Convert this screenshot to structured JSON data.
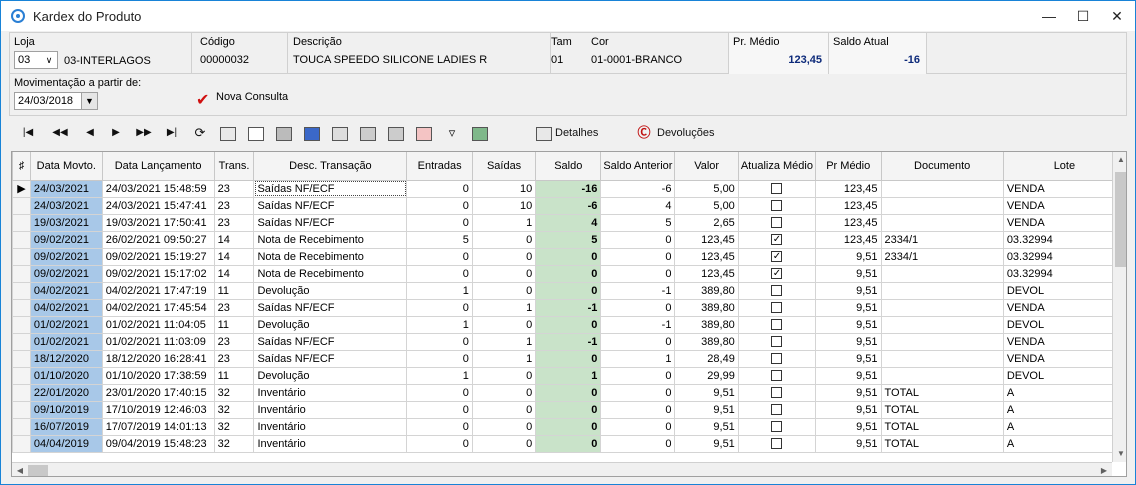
{
  "window": {
    "title": "Kardex do Produto",
    "min": "—",
    "max": "☐",
    "close": "✕"
  },
  "header": {
    "loja_label": "Loja",
    "loja_code": "03",
    "loja_name": "03-INTERLAGOS",
    "codigo_label": "Código",
    "codigo_value": "00000032",
    "descricao_label": "Descrição",
    "descricao_value": "TOUCA SPEEDO SILICONE LADIES R",
    "tam_label": "Tam",
    "tam_value": "01",
    "cor_label": "Cor",
    "cor_value": "01-0001-BRANCO",
    "pr_medio_label": "Pr. Médio",
    "pr_medio_value": "123,45",
    "saldo_atual_label": "Saldo Atual",
    "saldo_atual_value": "-16",
    "mov_label": "Movimentação a partir de:",
    "mov_date": "24/03/2018",
    "nova_consulta": "Nova Consulta"
  },
  "toolbar": {
    "detalhes": "Detalhes",
    "devolucoes": "Devoluções"
  },
  "columns": [
    "Data Movto.",
    "Data Lançamento",
    "Trans.",
    "Desc. Transação",
    "Entradas",
    "Saídas",
    "Saldo",
    "Saldo Anterior",
    "Valor",
    "Atualiza Médio",
    "Pr Médio",
    "Documento",
    "Lote"
  ],
  "rows": [
    {
      "dm": "24/03/2021",
      "dl": "24/03/2021 15:48:59",
      "tr": "23",
      "ds": "Saídas NF/ECF",
      "en": "0",
      "sa": "10",
      "sl": "-16",
      "ant": "-6",
      "val": "5,00",
      "chk": false,
      "pm": "123,45",
      "doc": "",
      "lote": "VENDA"
    },
    {
      "dm": "24/03/2021",
      "dl": "24/03/2021 15:47:41",
      "tr": "23",
      "ds": "Saídas NF/ECF",
      "en": "0",
      "sa": "10",
      "sl": "-6",
      "ant": "4",
      "val": "5,00",
      "chk": false,
      "pm": "123,45",
      "doc": "",
      "lote": "VENDA"
    },
    {
      "dm": "19/03/2021",
      "dl": "19/03/2021 17:50:41",
      "tr": "23",
      "ds": "Saídas NF/ECF",
      "en": "0",
      "sa": "1",
      "sl": "4",
      "ant": "5",
      "val": "2,65",
      "chk": false,
      "pm": "123,45",
      "doc": "",
      "lote": "VENDA"
    },
    {
      "dm": "09/02/2021",
      "dl": "26/02/2021 09:50:27",
      "tr": "14",
      "ds": "Nota de Recebimento",
      "en": "5",
      "sa": "0",
      "sl": "5",
      "ant": "0",
      "val": "123,45",
      "chk": true,
      "pm": "123,45",
      "doc": "2334/1",
      "lote": "03.32994"
    },
    {
      "dm": "09/02/2021",
      "dl": "09/02/2021 15:19:27",
      "tr": "14",
      "ds": "Nota de Recebimento",
      "en": "0",
      "sa": "0",
      "sl": "0",
      "ant": "0",
      "val": "123,45",
      "chk": true,
      "pm": "9,51",
      "doc": "2334/1",
      "lote": "03.32994"
    },
    {
      "dm": "09/02/2021",
      "dl": "09/02/2021 15:17:02",
      "tr": "14",
      "ds": "Nota de Recebimento",
      "en": "0",
      "sa": "0",
      "sl": "0",
      "ant": "0",
      "val": "123,45",
      "chk": true,
      "pm": "9,51",
      "doc": "",
      "lote": "03.32994"
    },
    {
      "dm": "04/02/2021",
      "dl": "04/02/2021 17:47:19",
      "tr": "11",
      "ds": "Devolução",
      "en": "1",
      "sa": "0",
      "sl": "0",
      "ant": "-1",
      "val": "389,80",
      "chk": false,
      "pm": "9,51",
      "doc": "",
      "lote": "DEVOL"
    },
    {
      "dm": "04/02/2021",
      "dl": "04/02/2021 17:45:54",
      "tr": "23",
      "ds": "Saídas NF/ECF",
      "en": "0",
      "sa": "1",
      "sl": "-1",
      "ant": "0",
      "val": "389,80",
      "chk": false,
      "pm": "9,51",
      "doc": "",
      "lote": "VENDA"
    },
    {
      "dm": "01/02/2021",
      "dl": "01/02/2021 11:04:05",
      "tr": "11",
      "ds": "Devolução",
      "en": "1",
      "sa": "0",
      "sl": "0",
      "ant": "-1",
      "val": "389,80",
      "chk": false,
      "pm": "9,51",
      "doc": "",
      "lote": "DEVOL"
    },
    {
      "dm": "01/02/2021",
      "dl": "01/02/2021 11:03:09",
      "tr": "23",
      "ds": "Saídas NF/ECF",
      "en": "0",
      "sa": "1",
      "sl": "-1",
      "ant": "0",
      "val": "389,80",
      "chk": false,
      "pm": "9,51",
      "doc": "",
      "lote": "VENDA"
    },
    {
      "dm": "18/12/2020",
      "dl": "18/12/2020 16:28:41",
      "tr": "23",
      "ds": "Saídas NF/ECF",
      "en": "0",
      "sa": "1",
      "sl": "0",
      "ant": "1",
      "val": "28,49",
      "chk": false,
      "pm": "9,51",
      "doc": "",
      "lote": "VENDA"
    },
    {
      "dm": "01/10/2020",
      "dl": "01/10/2020 17:38:59",
      "tr": "11",
      "ds": "Devolução",
      "en": "1",
      "sa": "0",
      "sl": "1",
      "ant": "0",
      "val": "29,99",
      "chk": false,
      "pm": "9,51",
      "doc": "",
      "lote": "DEVOL"
    },
    {
      "dm": "22/01/2020",
      "dl": "23/01/2020 17:40:15",
      "tr": "32",
      "ds": "Inventário",
      "en": "0",
      "sa": "0",
      "sl": "0",
      "ant": "0",
      "val": "9,51",
      "chk": false,
      "pm": "9,51",
      "doc": "TOTAL",
      "lote": "A"
    },
    {
      "dm": "09/10/2019",
      "dl": "17/10/2019 12:46:03",
      "tr": "32",
      "ds": "Inventário",
      "en": "0",
      "sa": "0",
      "sl": "0",
      "ant": "0",
      "val": "9,51",
      "chk": false,
      "pm": "9,51",
      "doc": "TOTAL",
      "lote": "A"
    },
    {
      "dm": "16/07/2019",
      "dl": "17/07/2019 14:01:13",
      "tr": "32",
      "ds": "Inventário",
      "en": "0",
      "sa": "0",
      "sl": "0",
      "ant": "0",
      "val": "9,51",
      "chk": false,
      "pm": "9,51",
      "doc": "TOTAL",
      "lote": "A"
    },
    {
      "dm": "04/04/2019",
      "dl": "09/04/2019 15:48:23",
      "tr": "32",
      "ds": "Inventário",
      "en": "0",
      "sa": "0",
      "sl": "0",
      "ant": "0",
      "val": "9,51",
      "chk": false,
      "pm": "9,51",
      "doc": "TOTAL",
      "lote": "A"
    }
  ]
}
